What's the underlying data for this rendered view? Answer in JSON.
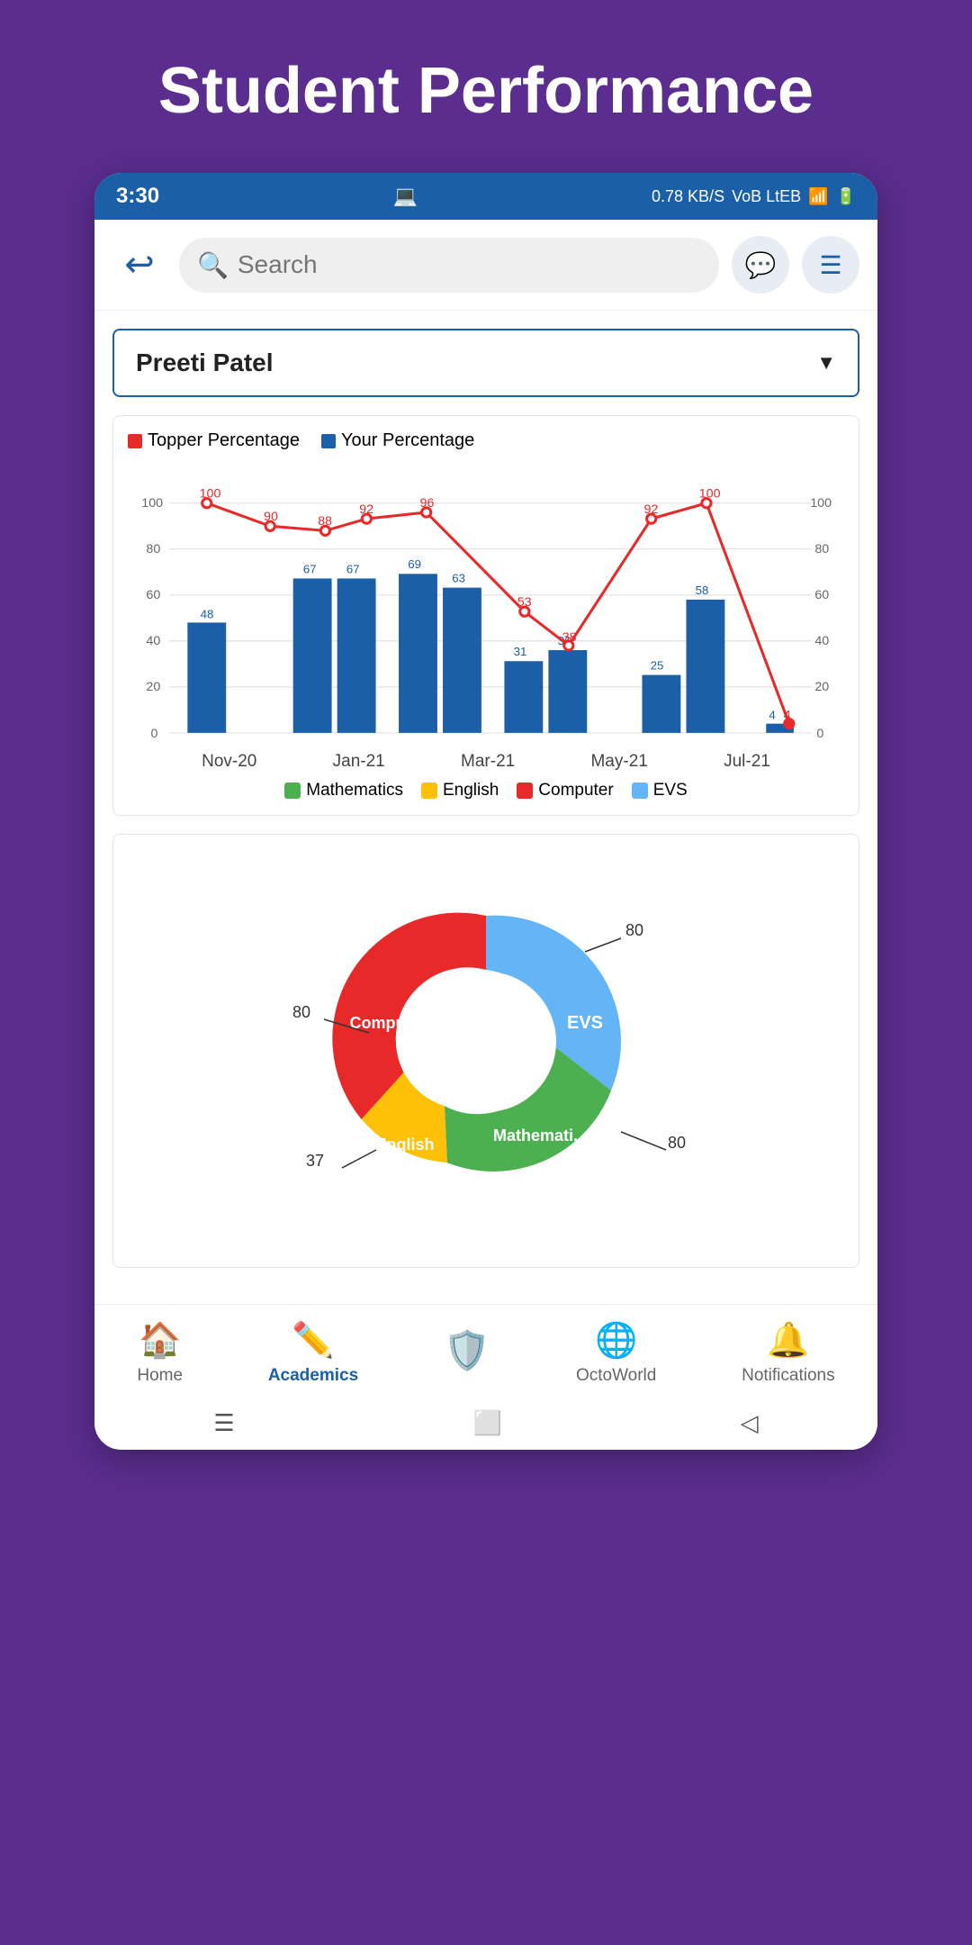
{
  "page": {
    "title": "Student Performance",
    "background_color": "#5b2d8e"
  },
  "status_bar": {
    "time": "3:30",
    "speed": "0.78 KB/S",
    "network": "4G",
    "battery": "6"
  },
  "header": {
    "search_placeholder": "Search",
    "student_name": "Preeti Patel"
  },
  "bar_chart": {
    "legend": [
      {
        "label": "Topper Percentage",
        "color": "#e8292a"
      },
      {
        "label": "Your Percentage",
        "color": "#1a5fa8"
      }
    ],
    "months": [
      "Nov-20",
      "Jan-21",
      "Mar-21",
      "May-21",
      "Jul-21"
    ],
    "topper_values": [
      100,
      90,
      88,
      92,
      96,
      53,
      38,
      92,
      100,
      4
    ],
    "your_values": [
      48,
      67,
      67,
      69,
      63,
      31,
      36,
      25,
      58,
      4
    ],
    "y_labels": [
      "0",
      "20",
      "40",
      "60",
      "80",
      "100"
    ],
    "subjects": [
      {
        "label": "Mathematics",
        "color": "#4caf50"
      },
      {
        "label": "English",
        "color": "#ffc107"
      },
      {
        "label": "Computer",
        "color": "#e8292a"
      },
      {
        "label": "EVS",
        "color": "#64b5f6"
      }
    ]
  },
  "donut_chart": {
    "segments": [
      {
        "label": "EVS",
        "value": 80,
        "color": "#64b5f6",
        "percent": 30
      },
      {
        "label": "Mathematics",
        "value": 80,
        "color": "#4caf50",
        "percent": 25
      },
      {
        "label": "English",
        "value": 37,
        "color": "#ffc107",
        "percent": 18
      },
      {
        "label": "Computer",
        "value": 80,
        "color": "#e8292a",
        "percent": 27
      }
    ],
    "labels": [
      {
        "text": "80",
        "side": "right"
      },
      {
        "text": "80",
        "side": "left"
      },
      {
        "text": "37",
        "side": "left"
      },
      {
        "text": "80",
        "side": "right"
      }
    ]
  },
  "bottom_nav": {
    "items": [
      {
        "label": "Home",
        "icon": "🏠",
        "active": false
      },
      {
        "label": "Academics",
        "icon": "✏️",
        "active": true
      },
      {
        "label": "",
        "icon": "🛡️",
        "active": false
      },
      {
        "label": "OctoWorld",
        "icon": "🌐",
        "active": false
      },
      {
        "label": "Notifications",
        "icon": "🔔",
        "active": false
      }
    ]
  }
}
